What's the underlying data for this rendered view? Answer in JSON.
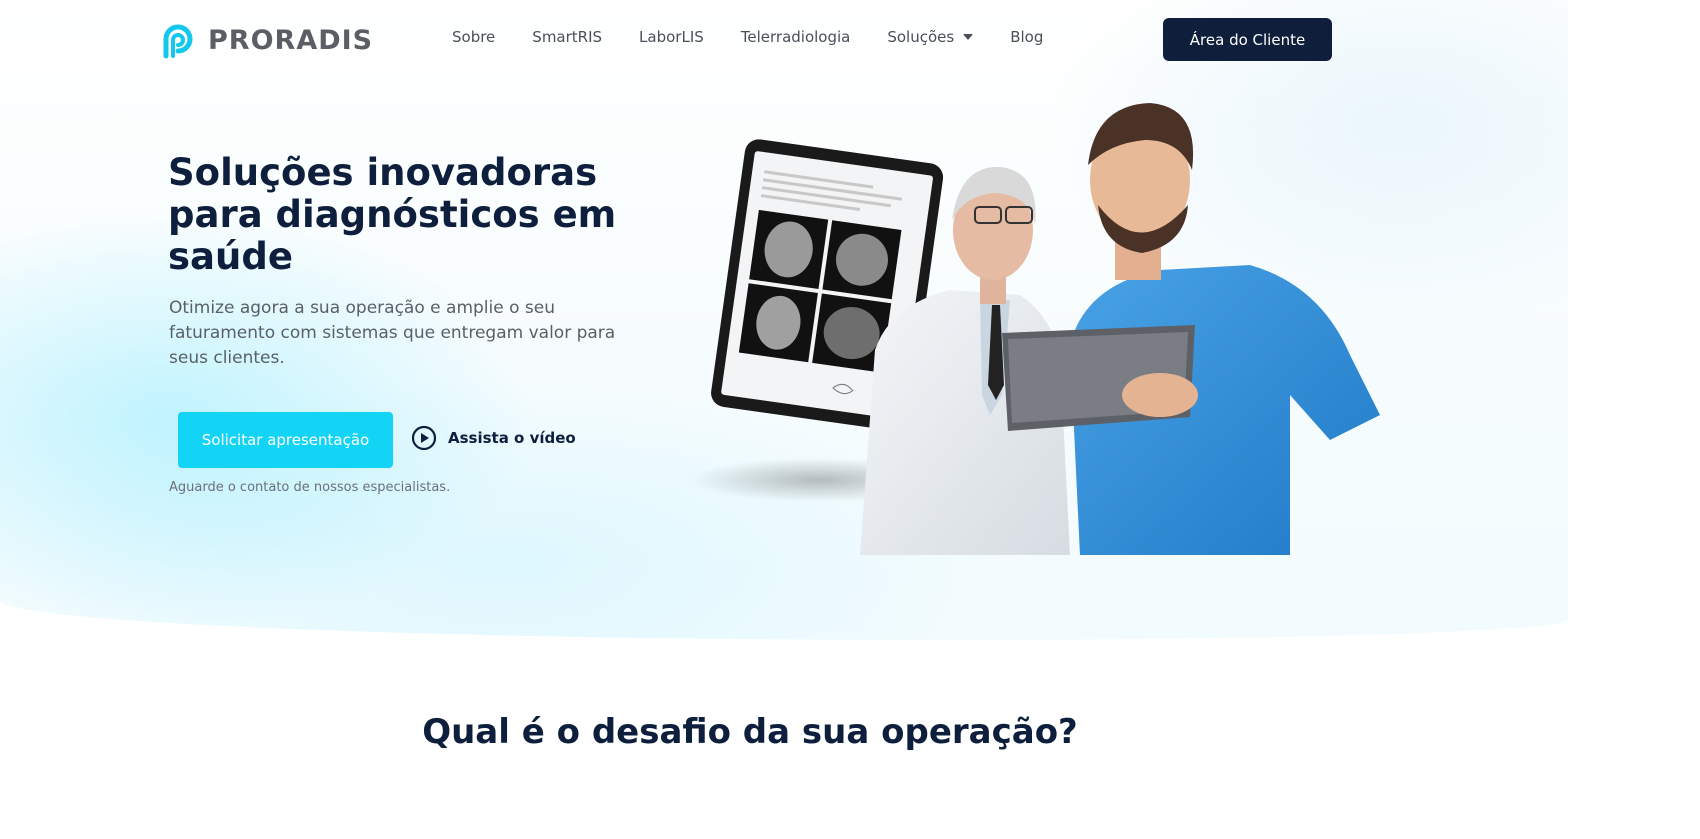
{
  "brand": {
    "name": "PRORADIS",
    "accent_color": "#13d4f5",
    "navy_color": "#0f1f3b"
  },
  "nav": {
    "items": [
      {
        "label": "Sobre"
      },
      {
        "label": "SmartRIS"
      },
      {
        "label": "LaborLIS"
      },
      {
        "label": "Telerradiologia"
      },
      {
        "label": "Soluções",
        "has_dropdown": true
      },
      {
        "label": "Blog"
      }
    ],
    "client_button": "Área do Cliente"
  },
  "hero": {
    "title": "Soluções inovadoras para diagnósticos em saúde",
    "subtitle": "Otimize agora a sua operação e amplie o seu faturamento com sistemas que entregam valor para seus clientes.",
    "cta_label": "Solicitar apresentação",
    "video_label": "Assista o vídeo",
    "note": "Aguarde o contato de nossos especialistas."
  },
  "section": {
    "title": "Qual é o desafio da sua operação?"
  },
  "icons": {
    "logo": "proradis-logo-icon",
    "dropdown": "chevron-down-icon",
    "play": "play-circle-icon"
  }
}
